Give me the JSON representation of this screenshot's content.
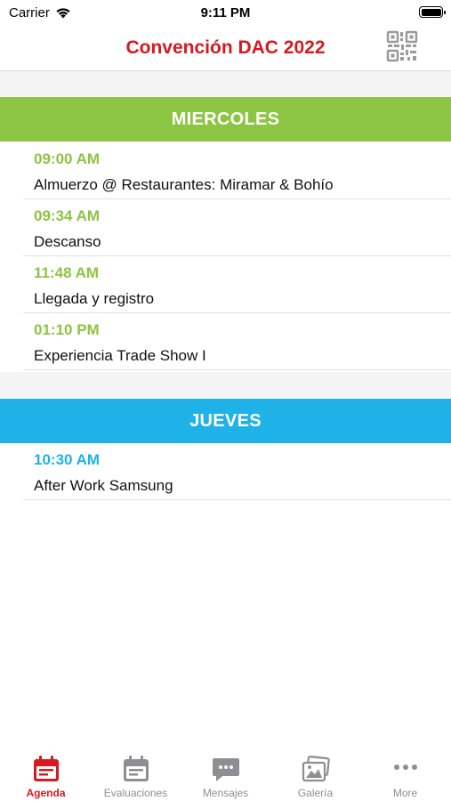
{
  "status_bar": {
    "carrier": "Carrier",
    "time": "9:11 PM"
  },
  "nav": {
    "title": "Convención DAC 2022",
    "qr_icon": "qr-code-icon"
  },
  "sections": [
    {
      "title": "MIERCOLES",
      "color": "#8bc541",
      "events": [
        {
          "time": "09:00 AM",
          "title": "Almuerzo @ Restaurantes: Miramar & Bohío"
        },
        {
          "time": "09:34 AM",
          "title": "Descanso"
        },
        {
          "time": "11:48 AM",
          "title": "Llegada y registro"
        },
        {
          "time": "01:10 PM",
          "title": "Experiencia Trade Show I"
        }
      ]
    },
    {
      "title": "JUEVES",
      "color": "#1fb2e8",
      "events": [
        {
          "time": "10:30 AM",
          "title": "After Work Samsung"
        }
      ]
    }
  ],
  "tabs": [
    {
      "label": "Agenda",
      "icon": "calendar-icon",
      "active": true
    },
    {
      "label": "Evaluaciones",
      "icon": "evaluation-icon",
      "active": false
    },
    {
      "label": "Mensajes",
      "icon": "message-icon",
      "active": false
    },
    {
      "label": "Galería",
      "icon": "gallery-icon",
      "active": false
    },
    {
      "label": "More",
      "icon": "more-icon",
      "active": false
    }
  ],
  "colors": {
    "brand_red": "#d71920",
    "inactive_gray": "#8e8e93"
  }
}
